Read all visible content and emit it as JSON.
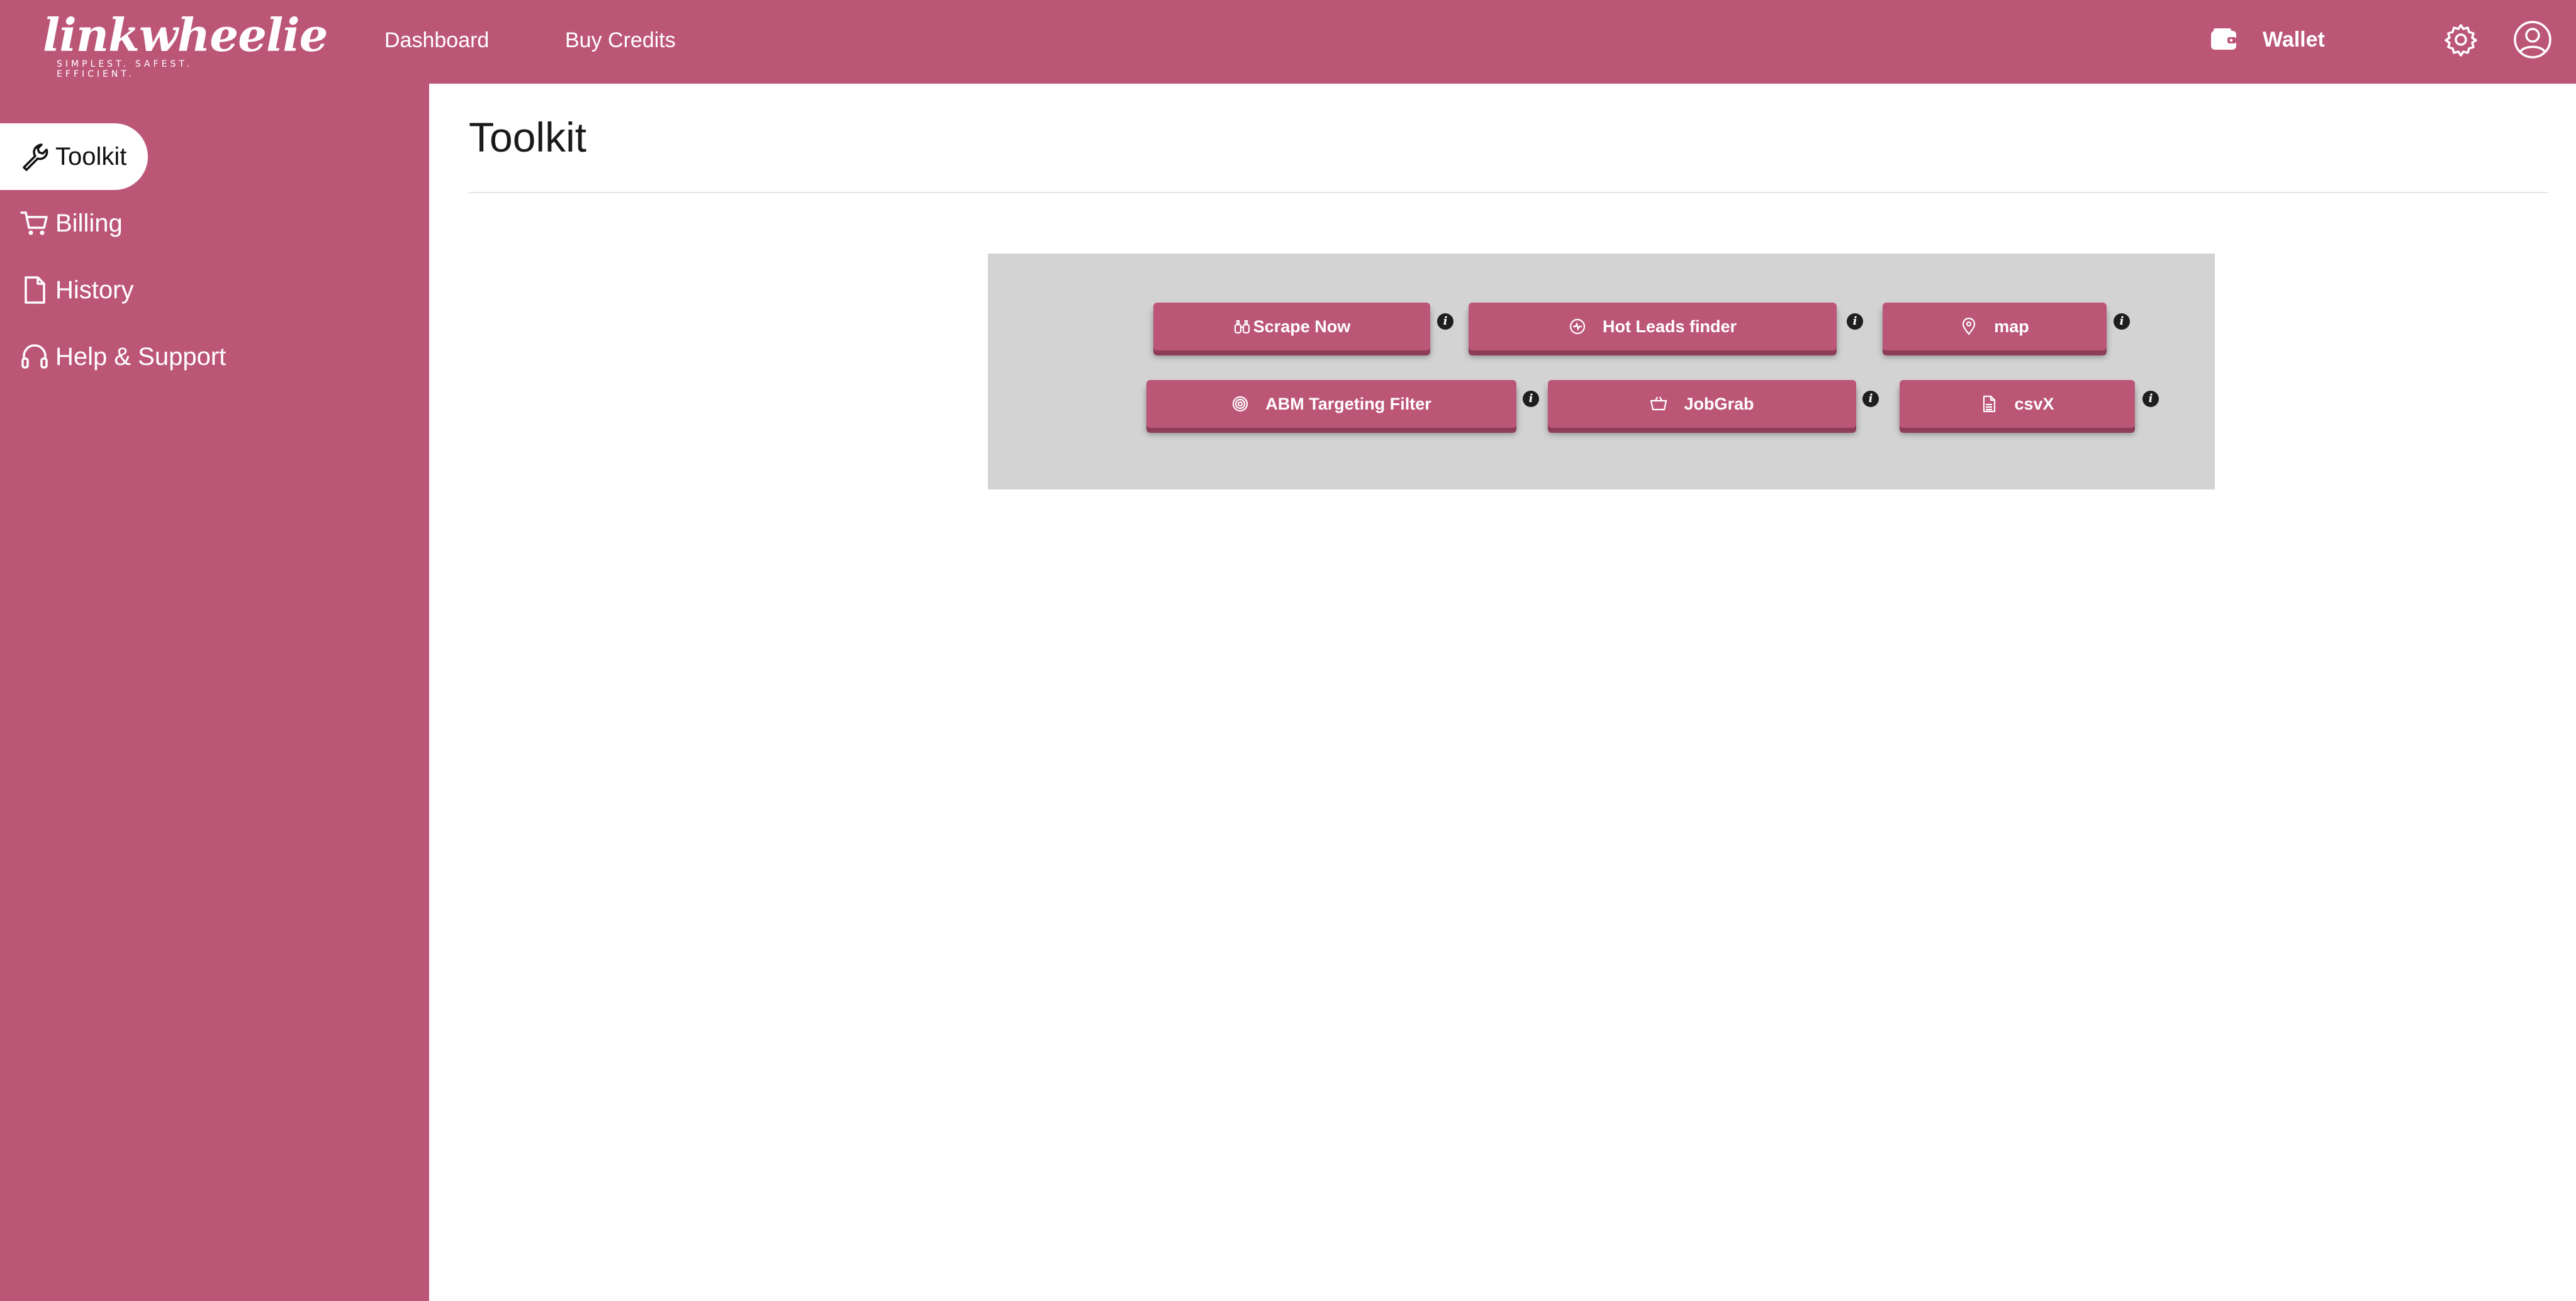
{
  "brand": {
    "name": "linkwheelie",
    "tagline": "SIMPLEST. SAFEST. EFFICIENT.",
    "color": "#bc5677"
  },
  "nav": {
    "links": [
      {
        "label": "Dashboard"
      },
      {
        "label": "Buy Credits"
      }
    ],
    "wallet_label": "Wallet",
    "icons": [
      "wallet-icon",
      "gear-icon",
      "user-circle-icon"
    ]
  },
  "sidebar": {
    "items": [
      {
        "label": "Toolkit",
        "icon": "wrench-icon",
        "active": true
      },
      {
        "label": "Billing",
        "icon": "cart-icon",
        "active": false
      },
      {
        "label": "History",
        "icon": "document-icon",
        "active": false
      },
      {
        "label": "Help & Support",
        "icon": "headset-icon",
        "active": false
      }
    ]
  },
  "main": {
    "title": "Toolkit",
    "tools": [
      {
        "label": "Scrape Now",
        "icon": "binoculars-icon"
      },
      {
        "label": "Hot Leads finder",
        "icon": "spark-circle-icon"
      },
      {
        "label": "map",
        "icon": "map-pin-icon"
      },
      {
        "label": "ABM Targeting Filter",
        "icon": "target-icon"
      },
      {
        "label": "JobGrab",
        "icon": "basket-icon"
      },
      {
        "label": "csvX",
        "icon": "csv-file-icon"
      }
    ],
    "info_glyph": "i"
  }
}
